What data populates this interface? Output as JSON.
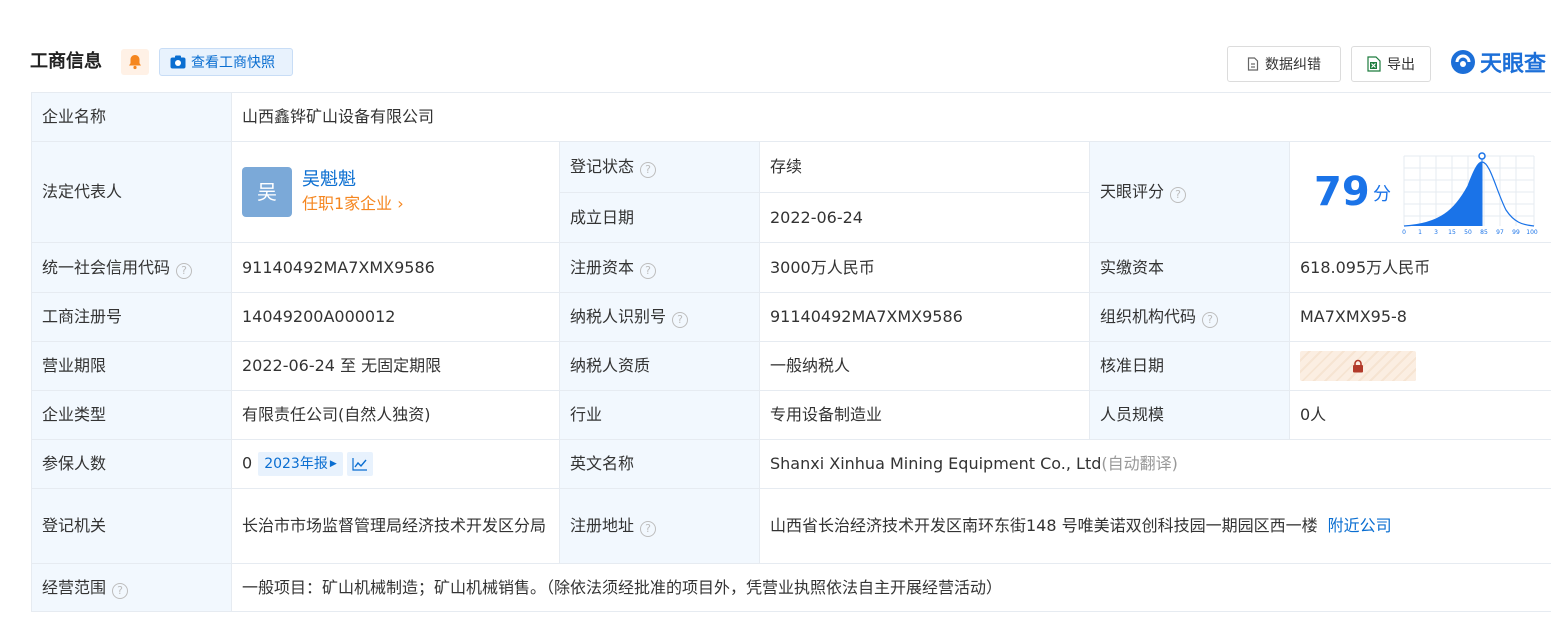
{
  "header": {
    "title": "工商信息",
    "snapshot_label": "查看工商快照",
    "correction_label": "数据纠错",
    "export_label": "导出",
    "brand": "天眼查"
  },
  "company": {
    "name_label": "企业名称",
    "name": "山西鑫铧矿山设备有限公司",
    "legal_rep_label": "法定代表人",
    "legal_rep_avatar": "吴",
    "legal_rep_name": "吴魁魁",
    "legal_rep_positions": "任职1家企业",
    "reg_status_label": "登记状态",
    "reg_status": "存续",
    "founded_label": "成立日期",
    "founded": "2022-06-24",
    "score_label": "天眼评分",
    "score": "79",
    "score_unit": "分",
    "score_axis": [
      "0",
      "1",
      "3",
      "15",
      "50",
      "85",
      "97",
      "99",
      "100"
    ],
    "credit_code_label": "统一社会信用代码",
    "credit_code": "91140492MA7XMX9586",
    "reg_capital_label": "注册资本",
    "reg_capital": "3000万人民币",
    "paid_capital_label": "实缴资本",
    "paid_capital": "618.095万人民币",
    "reg_no_label": "工商注册号",
    "reg_no": "14049200A000012",
    "taxpayer_id_label": "纳税人识别号",
    "taxpayer_id": "91140492MA7XMX9586",
    "org_code_label": "组织机构代码",
    "org_code": "MA7XMX95-8",
    "term_label": "营业期限",
    "term": "2022-06-24 至 无固定期限",
    "taxpayer_qual_label": "纳税人资质",
    "taxpayer_qual": "一般纳税人",
    "approval_date_label": "核准日期",
    "type_label": "企业类型",
    "type": "有限责任公司(自然人独资)",
    "industry_label": "行业",
    "industry": "专用设备制造业",
    "staff_label": "人员规模",
    "staff": "0人",
    "insured_label": "参保人数",
    "insured": "0",
    "insured_report": "2023年报",
    "en_name_label": "英文名称",
    "en_name": "Shanxi Xinhua Mining Equipment Co., Ltd",
    "en_name_note": "(自动翻译)",
    "authority_label": "登记机关",
    "authority": "长治市市场监督管理局经济技术开发区分局",
    "address_label": "注册地址",
    "address": "山西省长治经济技术开发区南环东街148 号唯美诺双创科技园一期园区西一楼",
    "nearby_label": "附近公司",
    "scope_label": "经营范围",
    "scope": "一般项目：矿山机械制造；矿山机械销售。（除依法须经批准的项目外，凭营业执照依法自主开展经营活动）"
  },
  "colors": {
    "label_bg": "#f2f8fe",
    "accent": "#0a6ed1",
    "status_green": "#28a745",
    "orange": "#f5861f"
  }
}
